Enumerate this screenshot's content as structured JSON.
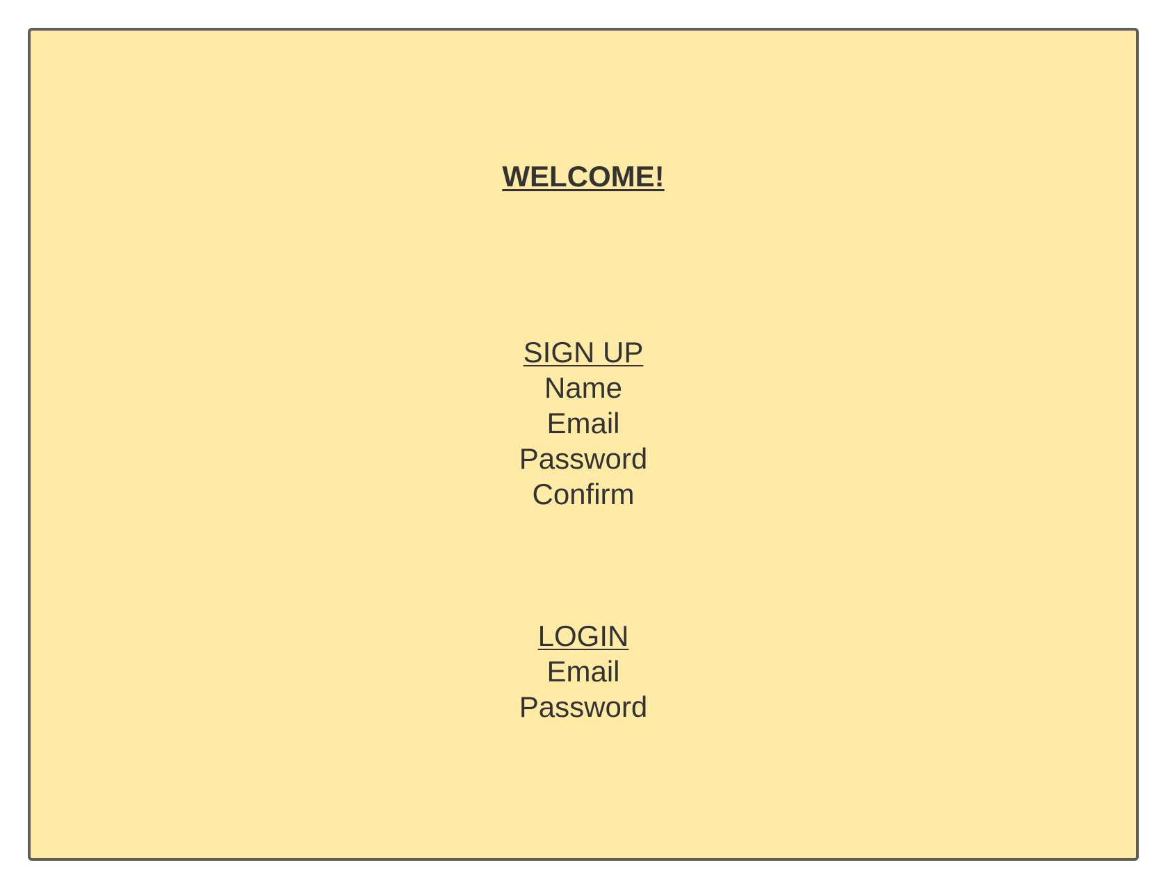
{
  "welcome": "WELCOME!",
  "signup": {
    "title": "SIGN UP",
    "fields": [
      "Name",
      "Email",
      "Password",
      "Confirm"
    ]
  },
  "login": {
    "title": "LOGIN",
    "fields": [
      "Email",
      "Password"
    ]
  },
  "colors": {
    "background": "#ffeba6",
    "border": "#5e5e5e",
    "text": "#333333"
  }
}
